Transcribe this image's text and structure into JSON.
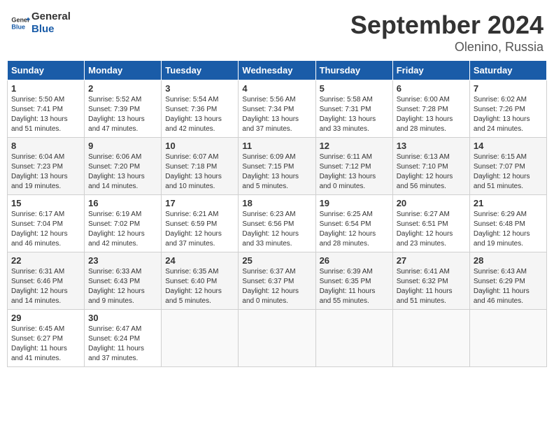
{
  "header": {
    "logo_line1": "General",
    "logo_line2": "Blue",
    "title": "September 2024",
    "subtitle": "Olenino, Russia"
  },
  "columns": [
    "Sunday",
    "Monday",
    "Tuesday",
    "Wednesday",
    "Thursday",
    "Friday",
    "Saturday"
  ],
  "weeks": [
    [
      {
        "day": "1",
        "info": "Sunrise: 5:50 AM\nSunset: 7:41 PM\nDaylight: 13 hours\nand 51 minutes."
      },
      {
        "day": "2",
        "info": "Sunrise: 5:52 AM\nSunset: 7:39 PM\nDaylight: 13 hours\nand 47 minutes."
      },
      {
        "day": "3",
        "info": "Sunrise: 5:54 AM\nSunset: 7:36 PM\nDaylight: 13 hours\nand 42 minutes."
      },
      {
        "day": "4",
        "info": "Sunrise: 5:56 AM\nSunset: 7:34 PM\nDaylight: 13 hours\nand 37 minutes."
      },
      {
        "day": "5",
        "info": "Sunrise: 5:58 AM\nSunset: 7:31 PM\nDaylight: 13 hours\nand 33 minutes."
      },
      {
        "day": "6",
        "info": "Sunrise: 6:00 AM\nSunset: 7:28 PM\nDaylight: 13 hours\nand 28 minutes."
      },
      {
        "day": "7",
        "info": "Sunrise: 6:02 AM\nSunset: 7:26 PM\nDaylight: 13 hours\nand 24 minutes."
      }
    ],
    [
      {
        "day": "8",
        "info": "Sunrise: 6:04 AM\nSunset: 7:23 PM\nDaylight: 13 hours\nand 19 minutes."
      },
      {
        "day": "9",
        "info": "Sunrise: 6:06 AM\nSunset: 7:20 PM\nDaylight: 13 hours\nand 14 minutes."
      },
      {
        "day": "10",
        "info": "Sunrise: 6:07 AM\nSunset: 7:18 PM\nDaylight: 13 hours\nand 10 minutes."
      },
      {
        "day": "11",
        "info": "Sunrise: 6:09 AM\nSunset: 7:15 PM\nDaylight: 13 hours\nand 5 minutes."
      },
      {
        "day": "12",
        "info": "Sunrise: 6:11 AM\nSunset: 7:12 PM\nDaylight: 13 hours\nand 0 minutes."
      },
      {
        "day": "13",
        "info": "Sunrise: 6:13 AM\nSunset: 7:10 PM\nDaylight: 12 hours\nand 56 minutes."
      },
      {
        "day": "14",
        "info": "Sunrise: 6:15 AM\nSunset: 7:07 PM\nDaylight: 12 hours\nand 51 minutes."
      }
    ],
    [
      {
        "day": "15",
        "info": "Sunrise: 6:17 AM\nSunset: 7:04 PM\nDaylight: 12 hours\nand 46 minutes."
      },
      {
        "day": "16",
        "info": "Sunrise: 6:19 AM\nSunset: 7:02 PM\nDaylight: 12 hours\nand 42 minutes."
      },
      {
        "day": "17",
        "info": "Sunrise: 6:21 AM\nSunset: 6:59 PM\nDaylight: 12 hours\nand 37 minutes."
      },
      {
        "day": "18",
        "info": "Sunrise: 6:23 AM\nSunset: 6:56 PM\nDaylight: 12 hours\nand 33 minutes."
      },
      {
        "day": "19",
        "info": "Sunrise: 6:25 AM\nSunset: 6:54 PM\nDaylight: 12 hours\nand 28 minutes."
      },
      {
        "day": "20",
        "info": "Sunrise: 6:27 AM\nSunset: 6:51 PM\nDaylight: 12 hours\nand 23 minutes."
      },
      {
        "day": "21",
        "info": "Sunrise: 6:29 AM\nSunset: 6:48 PM\nDaylight: 12 hours\nand 19 minutes."
      }
    ],
    [
      {
        "day": "22",
        "info": "Sunrise: 6:31 AM\nSunset: 6:46 PM\nDaylight: 12 hours\nand 14 minutes."
      },
      {
        "day": "23",
        "info": "Sunrise: 6:33 AM\nSunset: 6:43 PM\nDaylight: 12 hours\nand 9 minutes."
      },
      {
        "day": "24",
        "info": "Sunrise: 6:35 AM\nSunset: 6:40 PM\nDaylight: 12 hours\nand 5 minutes."
      },
      {
        "day": "25",
        "info": "Sunrise: 6:37 AM\nSunset: 6:37 PM\nDaylight: 12 hours\nand 0 minutes."
      },
      {
        "day": "26",
        "info": "Sunrise: 6:39 AM\nSunset: 6:35 PM\nDaylight: 11 hours\nand 55 minutes."
      },
      {
        "day": "27",
        "info": "Sunrise: 6:41 AM\nSunset: 6:32 PM\nDaylight: 11 hours\nand 51 minutes."
      },
      {
        "day": "28",
        "info": "Sunrise: 6:43 AM\nSunset: 6:29 PM\nDaylight: 11 hours\nand 46 minutes."
      }
    ],
    [
      {
        "day": "29",
        "info": "Sunrise: 6:45 AM\nSunset: 6:27 PM\nDaylight: 11 hours\nand 41 minutes."
      },
      {
        "day": "30",
        "info": "Sunrise: 6:47 AM\nSunset: 6:24 PM\nDaylight: 11 hours\nand 37 minutes."
      },
      {
        "day": "",
        "info": ""
      },
      {
        "day": "",
        "info": ""
      },
      {
        "day": "",
        "info": ""
      },
      {
        "day": "",
        "info": ""
      },
      {
        "day": "",
        "info": ""
      }
    ]
  ]
}
